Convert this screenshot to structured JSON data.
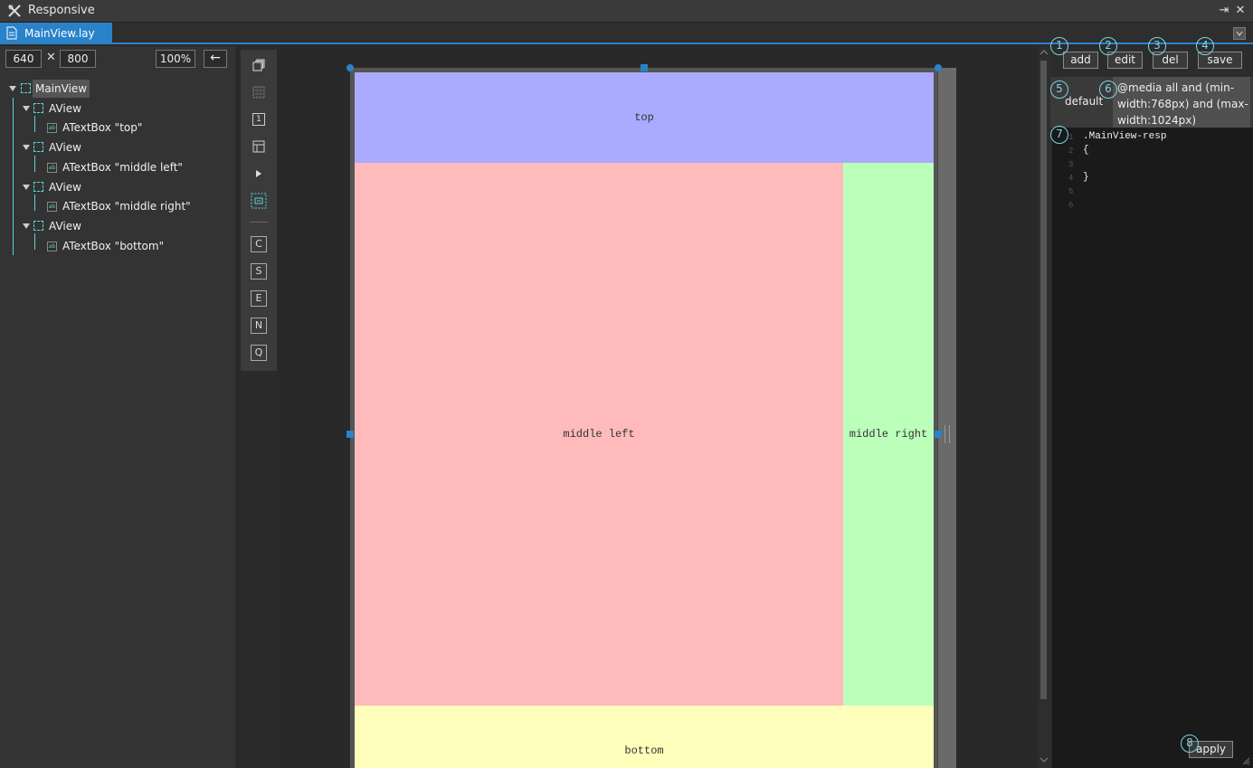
{
  "window": {
    "title": "Responsive"
  },
  "tab": {
    "label": "MainView.lay"
  },
  "size": {
    "width": "640",
    "height": "800",
    "times": "✕",
    "zoom": "100%",
    "back": "←"
  },
  "tree": {
    "root": "MainView",
    "items": [
      {
        "label": "AView"
      },
      {
        "label": "ATextBox \"top\""
      },
      {
        "label": "AView"
      },
      {
        "label": "ATextBox \"middle left\""
      },
      {
        "label": "AView"
      },
      {
        "label": "ATextBox \"middle right\""
      },
      {
        "label": "AView"
      },
      {
        "label": "ATextBox \"bottom\""
      }
    ]
  },
  "tools": {
    "c": "C",
    "s": "S",
    "e": "E",
    "n": "N",
    "q": "Q",
    "one": "1"
  },
  "canvas": {
    "top": "top",
    "middle_left": "middle left",
    "middle_right": "middle right",
    "bottom": "bottom"
  },
  "colors": {
    "top": "#aaaaff",
    "middle_left": "#ffbbbb",
    "middle_right": "#bbffbb",
    "bottom": "#ffffbb",
    "accent": "#2a82c9"
  },
  "panel": {
    "buttons": {
      "add": "add",
      "edit": "edit",
      "del": "del",
      "save": "save",
      "apply": "apply"
    },
    "markers": [
      "1",
      "2",
      "3",
      "4",
      "5",
      "6",
      "7",
      "8"
    ],
    "media_default": "default",
    "media_query": "@media all and (min-width:768px) and (max-width:1024px)",
    "code_lines": [
      ".MainView-resp",
      "{",
      "",
      "}",
      "",
      ""
    ],
    "line_numbers": [
      "1",
      "2",
      "3",
      "4",
      "5",
      "6"
    ]
  }
}
